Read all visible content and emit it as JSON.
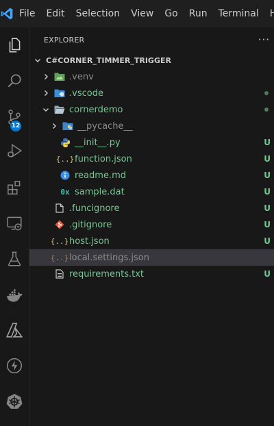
{
  "menu": [
    "File",
    "Edit",
    "Selection",
    "View",
    "Go",
    "Run",
    "Terminal",
    "He"
  ],
  "activity": {
    "source_control_badge": "12"
  },
  "explorer": {
    "title": "EXPLORER",
    "more": "···",
    "section": "C#CORNER_TIMMER_TRIGGER",
    "rows": [
      {
        "label": ".venv",
        "status": ""
      },
      {
        "label": ".vscode",
        "status": ""
      },
      {
        "label": "cornerdemo",
        "status": ""
      },
      {
        "label": "__pycache__",
        "status": ""
      },
      {
        "label": "__init__.py",
        "status": "U"
      },
      {
        "label": "function.json",
        "status": "U"
      },
      {
        "label": "readme.md",
        "status": "U"
      },
      {
        "label": "sample.dat",
        "status": "U"
      },
      {
        "label": ".funcignore",
        "status": "U"
      },
      {
        "label": ".gitignore",
        "status": "U"
      },
      {
        "label": "host.json",
        "status": "U"
      },
      {
        "label": "local.settings.json",
        "status": ""
      },
      {
        "label": "requirements.txt",
        "status": "U"
      }
    ]
  },
  "colors": {
    "accent": "#0078d4",
    "untracked": "#73c991",
    "ignored": "#8c8c8c"
  }
}
